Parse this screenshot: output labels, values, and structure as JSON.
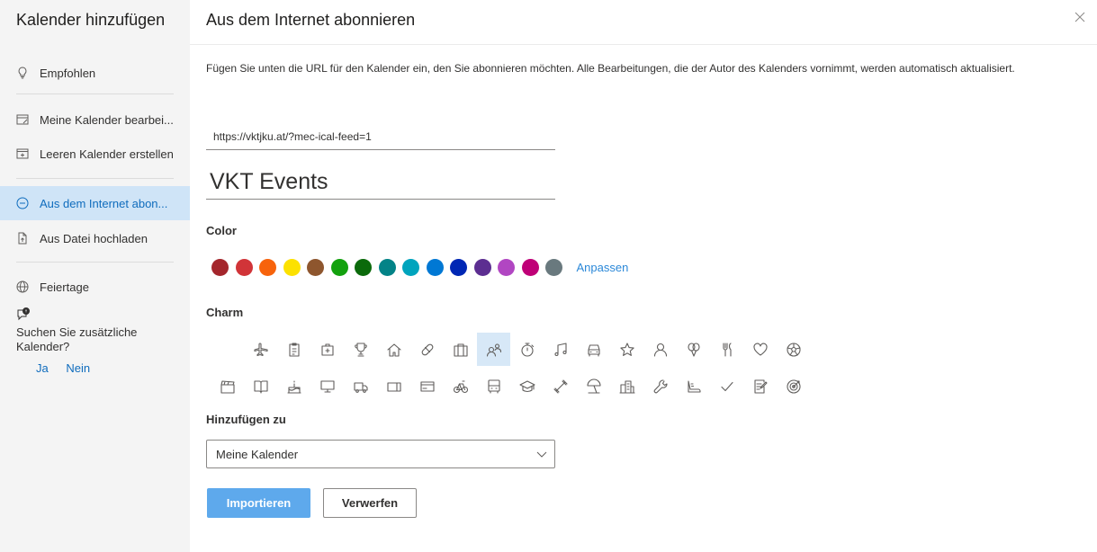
{
  "sidebar": {
    "title": "Kalender hinzufügen",
    "items": [
      {
        "label": "Empfohlen",
        "icon": "lightbulb-icon"
      },
      {
        "label": "Meine Kalender bearbei...",
        "icon": "edit-calendar-icon"
      },
      {
        "label": "Leeren Kalender erstellen",
        "icon": "add-calendar-icon"
      },
      {
        "label": "Aus dem Internet abon...",
        "icon": "subscribe-link-icon",
        "active": true
      },
      {
        "label": "Aus Datei hochladen",
        "icon": "file-upload-icon"
      },
      {
        "label": "Feiertage",
        "icon": "globe-icon"
      }
    ],
    "more_text": "Suchen Sie zusätzliche Kalender?",
    "yes_label": "Ja",
    "no_label": "Nein"
  },
  "main": {
    "title": "Aus dem Internet abonnieren",
    "description": "Fügen Sie unten die URL für den Kalender ein, den Sie abonnieren möchten. Alle Bearbeitungen, die der Autor des Kalenders vornimmt, werden automatisch aktualisiert.",
    "url_value": "https://vktjku.at/?mec-ical-feed=1",
    "name_value": "VKT Events",
    "color_label": "Color",
    "colors": [
      "#a4262c",
      "#d13438",
      "#f7630c",
      "#fce100",
      "#8e562e",
      "#13a10e",
      "#0b6a0b",
      "#038387",
      "#00a4bd",
      "#0078d4",
      "#0027b4",
      "#5c2e91",
      "#b146c2",
      "#bf0077",
      "#69797e"
    ],
    "customize_label": "Anpassen",
    "charm_label": "Charm",
    "charms_row1": [
      "airplane-icon",
      "clipboard-icon",
      "first-aid-icon",
      "trophy-icon",
      "home-icon",
      "pill-icon",
      "briefcase-icon",
      "people-icon",
      "stopwatch-icon",
      "music-icon",
      "car-icon",
      "star-icon",
      "person-icon",
      "balloons-icon",
      "cutlery-icon",
      "heart-icon",
      "soccer-ball-icon"
    ],
    "charms_row2": [
      "movie-clapper-icon",
      "book-icon",
      "birthday-cake-icon",
      "monitor-icon",
      "truck-icon",
      "ticket-icon",
      "payment-card-icon",
      "bicycle-icon",
      "bus-icon",
      "graduation-cap-icon",
      "dumbbell-icon",
      "beach-umbrella-icon",
      "city-icon",
      "wrench-icon",
      "sneaker-icon",
      "checkmark-icon",
      "notes-icon",
      "target-icon"
    ],
    "selected_charm": "people-icon",
    "add_to_label": "Hinzufügen zu",
    "add_to_value": "Meine Kalender",
    "import_label": "Importieren",
    "discard_label": "Verwerfen"
  }
}
